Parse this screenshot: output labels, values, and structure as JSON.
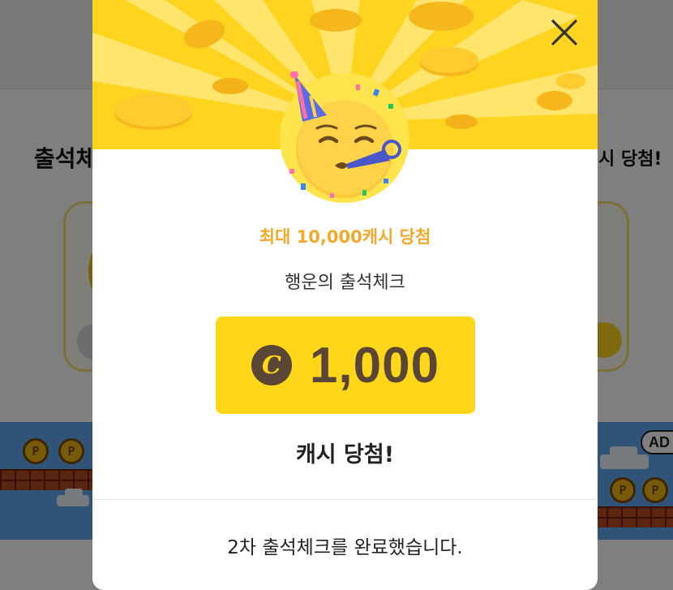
{
  "background": {
    "title_left": "출석체",
    "title_right": "시 당첨!",
    "coin_label": "P",
    "ad_label": "AD"
  },
  "modal": {
    "close_icon": "close-icon",
    "hero_emoji": "partying-face-emoji",
    "eyebrow": "최대 10,000캐시 당첨",
    "subtitle": "행운의 출석체크",
    "cash_symbol": "C",
    "amount": "1,000",
    "result": "캐시 당첨!",
    "footer": "2차 출석체크를 완료했습니다."
  },
  "colors": {
    "accent_yellow": "#ffd61a",
    "eyebrow_orange": "#f2a92a",
    "amount_brown": "#5a4636"
  }
}
